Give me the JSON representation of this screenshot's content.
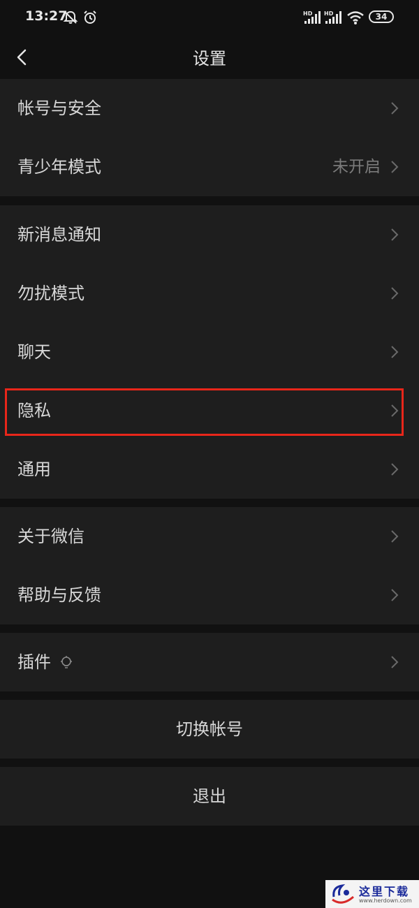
{
  "status_bar": {
    "time": "13:27",
    "battery": "34",
    "icons": [
      "mute-bell-icon",
      "alarm-icon",
      "hd-signal-icon",
      "hd-signal-icon",
      "wifi-icon",
      "battery-icon"
    ]
  },
  "nav": {
    "title": "设置",
    "back_icon": "back-arrow-icon"
  },
  "groups": [
    {
      "items": [
        {
          "label": "帐号与安全",
          "value": ""
        },
        {
          "label": "青少年模式",
          "value": "未开启"
        }
      ]
    },
    {
      "items": [
        {
          "label": "新消息通知",
          "value": ""
        },
        {
          "label": "勿扰模式",
          "value": ""
        },
        {
          "label": "聊天",
          "value": ""
        },
        {
          "label": "隐私",
          "value": "",
          "highlighted": true
        },
        {
          "label": "通用",
          "value": ""
        }
      ]
    },
    {
      "items": [
        {
          "label": "关于微信",
          "value": ""
        },
        {
          "label": "帮助与反馈",
          "value": ""
        }
      ]
    },
    {
      "items": [
        {
          "label": "插件",
          "value": "",
          "icon": "lightbulb-icon"
        }
      ]
    }
  ],
  "actions": {
    "switch_account": "切换帐号",
    "logout": "退出"
  },
  "colors": {
    "background": "#111111",
    "cell_background": "#1e1e1e",
    "text": "#d8d8d8",
    "secondary_text": "#7b7b7b",
    "highlight": "#e8261a"
  },
  "watermark": {
    "text": "这里下载",
    "url": "www.herdown.com"
  }
}
